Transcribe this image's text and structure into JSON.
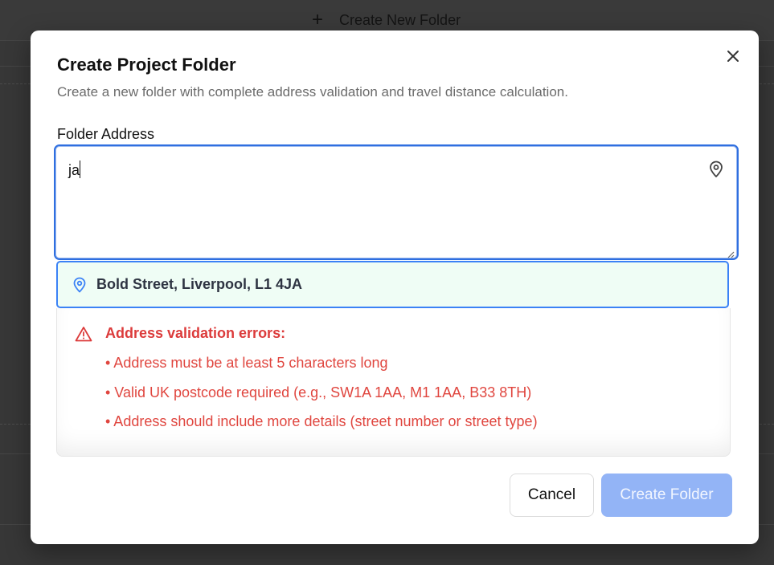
{
  "background": {
    "create_folder_label": "Create New Folder",
    "plus_icon": "plus-icon"
  },
  "modal": {
    "title": "Create Project Folder",
    "subtitle": "Create a new folder with complete address validation and travel distance calculation.",
    "close_icon": "close-icon",
    "field_label": "Folder Address",
    "address_value": "ja",
    "suggestion": "Bold Street, Liverpool, L1 4JA",
    "errors": {
      "title": "Address validation errors:",
      "items": [
        "• Address must be at least 5 characters long",
        "• Valid UK postcode required (e.g., SW1A 1AA, M1 1AA, B33 8TH)",
        "• Address should include more details (street number or street type)"
      ]
    },
    "buttons": {
      "cancel": "Cancel",
      "create": "Create Folder"
    }
  },
  "colors": {
    "accent": "#2f6fe0",
    "error": "#dc3b3b",
    "suggestion_bg": "#effdf5",
    "create_button_disabled": "#93b4f6"
  }
}
